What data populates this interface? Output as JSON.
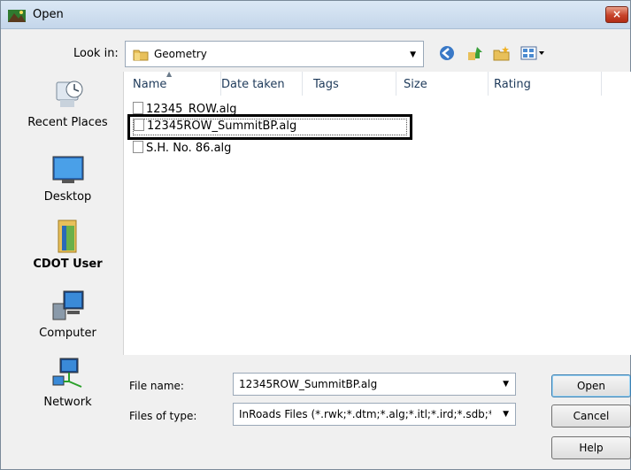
{
  "window": {
    "title": "Open",
    "close_glyph": "×"
  },
  "lookin": {
    "label": "Look in:",
    "value": "Geometry"
  },
  "toolbar": [
    "back-icon",
    "up-folder-icon",
    "new-folder-icon",
    "views-menu-icon"
  ],
  "places": [
    {
      "label": "Recent Places",
      "icon": "recent-places-icon"
    },
    {
      "label": "Desktop",
      "icon": "desktop-icon"
    },
    {
      "label": "CDOT User",
      "icon": "user-folder-icon"
    },
    {
      "label": "Computer",
      "icon": "computer-icon"
    },
    {
      "label": "Network",
      "icon": "network-icon"
    }
  ],
  "columns": [
    "Name",
    "Date taken",
    "Tags",
    "Size",
    "Rating"
  ],
  "files": [
    "12345_ROW.alg",
    "12345ROW_SummitBP.alg",
    "S.H. No. 86.alg"
  ],
  "selected_index": 1,
  "filename": {
    "label": "File name:",
    "value": "12345ROW_SummitBP.alg"
  },
  "filetype": {
    "label": "Files of type:",
    "value": "InRoads Files (*.rwk;*.dtm;*.alg;*.itl;*.ird;*.sdb;*.>"
  },
  "buttons": {
    "open": "Open",
    "cancel": "Cancel",
    "help": "Help"
  },
  "colors": {
    "accent": "#3c7fb1",
    "titlebar": "#c4d6ea",
    "close": "#c7432b"
  }
}
